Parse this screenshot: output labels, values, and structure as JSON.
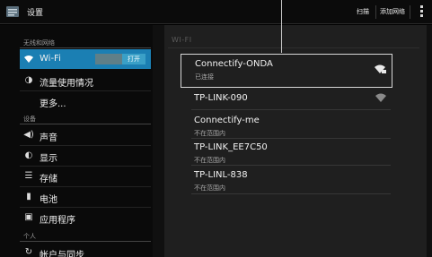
{
  "actionbar": {
    "title": "设置",
    "scan_label": "扫描",
    "add_network_label": "添加网络"
  },
  "sidebar": {
    "section_wireless": "无线和网络",
    "section_device": "设备",
    "section_personal": "个人",
    "wifi": {
      "label": "Wi-Fi",
      "toggle_label": "打开"
    },
    "items": [
      {
        "label": "流量使用情况"
      },
      {
        "label": "更多..."
      },
      {
        "label": "声音"
      },
      {
        "label": "显示"
      },
      {
        "label": "存储"
      },
      {
        "label": "电池"
      },
      {
        "label": "应用程序"
      },
      {
        "label": "帐户与同步"
      }
    ]
  },
  "wifi_panel": {
    "header": "WI-FI",
    "networks": [
      {
        "name": "Connectify-ONDA",
        "status": "已连接",
        "signal_icon": "wifi-lock-icon"
      },
      {
        "name": "TP-LINK-090",
        "status": "",
        "signal_icon": "wifi-icon"
      },
      {
        "name": "Connectify-me",
        "status": "不在范围内"
      },
      {
        "name": "TP-LINK_EE7C50",
        "status": "不在范围内"
      },
      {
        "name": "TP-LINL-838",
        "status": "不在范围内"
      }
    ]
  },
  "colors": {
    "accent": "#1b7fb3",
    "toggle_on": "#3aa0c7"
  }
}
